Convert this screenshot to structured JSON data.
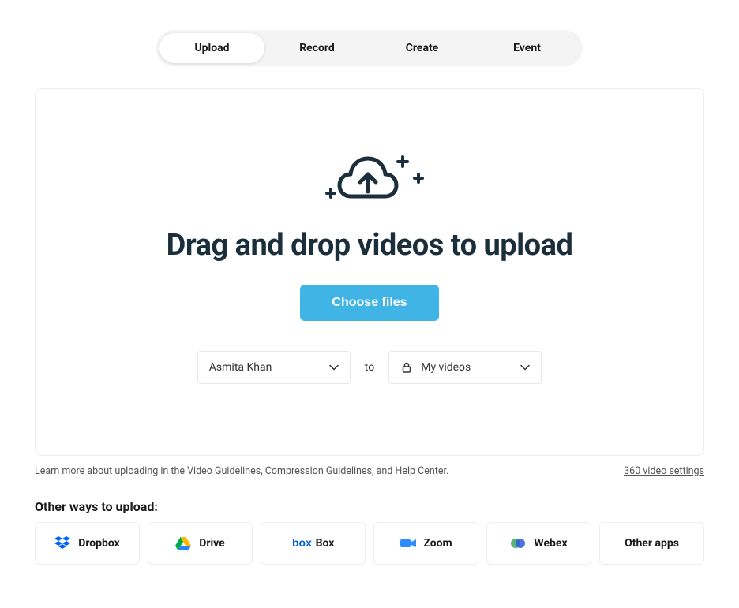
{
  "tabs": [
    {
      "label": "Upload",
      "active": true
    },
    {
      "label": "Record",
      "active": false
    },
    {
      "label": "Create",
      "active": false
    },
    {
      "label": "Event",
      "active": false
    }
  ],
  "upload": {
    "heading": "Drag and drop videos to upload",
    "choose_button": "Choose files",
    "owner_select": "Asmita Khan",
    "to_label": "to",
    "destination_select": "My videos"
  },
  "footer": {
    "learn_more": "Learn more about uploading in the Video Guidelines, Compression Guidelines, and Help Center.",
    "video_settings_link": "360 video settings"
  },
  "other_ways": {
    "title": "Other ways to upload:",
    "apps": [
      {
        "name": "Dropbox",
        "icon": "dropbox"
      },
      {
        "name": "Drive",
        "icon": "drive"
      },
      {
        "name": "Box",
        "icon": "box"
      },
      {
        "name": "Zoom",
        "icon": "zoom"
      },
      {
        "name": "Webex",
        "icon": "webex"
      },
      {
        "name": "Other apps",
        "icon": null
      }
    ]
  }
}
